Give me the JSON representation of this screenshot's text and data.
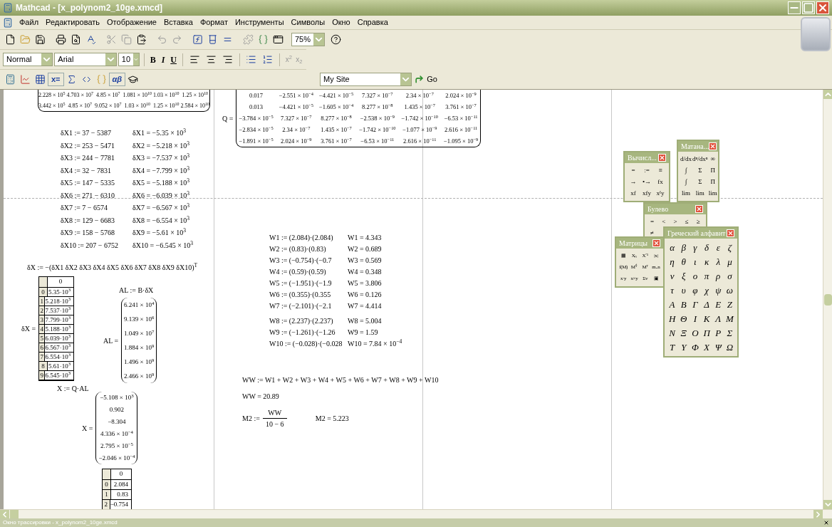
{
  "window": {
    "title": "Mathcad - [x_polynom2_10ge.xmcd]"
  },
  "menu": [
    "Файл",
    "Редактировать",
    "Отображение",
    "Вставка",
    "Формат",
    "Инструменты",
    "Символы",
    "Окно",
    "Справка"
  ],
  "standard_toolbar": {
    "zoom": "75%"
  },
  "formatting_toolbar": {
    "style": "Normal",
    "font": "Arial",
    "size": "10",
    "text_buttons": [
      "B",
      "I",
      "U"
    ],
    "script_buttons": [
      "x$^{2}$",
      "x$_{2}$"
    ]
  },
  "math_toolbar": {
    "evaluation_label": "x=",
    "greek_label": "αβ"
  },
  "web_toolbar": {
    "address": "My Site",
    "go": "Go"
  },
  "worksheet": {
    "top_matrix": {
      "rows": [
        [
          "2.228 × 10$^{5}$",
          "4.703 × 10$^{7}$",
          "4.85 × 10$^{7}$",
          "1.081 × 10$^{10}$",
          "1.03 × 10$^{10}$",
          "1.25 × 10$^{10}$"
        ],
        [
          "3.442 × 10$^{5}$",
          "4.85 × 10$^{7}$",
          "9.052 × 10$^{7}$",
          "1.03 × 10$^{10}$",
          "1.25 × 10$^{10}$",
          "2.584 × 10$^{10}$"
        ]
      ]
    },
    "q_matrix": {
      "label": "Q =",
      "rows": [
        [
          "0.017",
          "−2.551 × 10$^{−4}$",
          "−4.421 × 10$^{−5}$",
          "7.327 × 10$^{−7}$",
          "2.34 × 10$^{−7}$",
          "2.024 × 10$^{−9}$"
        ],
        [
          "0.013",
          "−4.421 × 10$^{−5}$",
          "−1.605 × 10$^{−4}$",
          "8.277 × 10$^{−8}$",
          "1.435 × 10$^{−7}$",
          "3.761 × 10$^{−7}$"
        ],
        [
          "−3.784 × 10$^{−5}$",
          "7.327 × 10$^{−7}$",
          "8.277 × 10$^{−8}$",
          "−2.538 × 10$^{−9}$",
          "−1.742 × 10$^{−10}$",
          "−6.53 × 10$^{−11}$"
        ],
        [
          "−2.834 × 10$^{−5}$",
          "2.34 × 10$^{−7}$",
          "1.435 × 10$^{−7}$",
          "−1.742 × 10$^{−10}$",
          "−1.077 × 10$^{−9}$",
          "2.616 × 10$^{−11}$"
        ],
        [
          "−1.891 × 10$^{−5}$",
          "2.024 × 10$^{−9}$",
          "3.761 × 10$^{−7}$",
          "−6.53 × 10$^{−11}$",
          "2.616 × 10$^{−11}$",
          "−1.095 × 10$^{−9}$"
        ]
      ]
    },
    "delta_definitions": [
      {
        "definition": "δX1 := 37 − 5387",
        "result": "δX1 = −5.35 × 10$^{3}$"
      },
      {
        "definition": "δX2 := 253 − 5471",
        "result": "δX2 = −5.218 × 10$^{3}$"
      },
      {
        "definition": "δX3 := 244 − 7781",
        "result": "δX3 = −7.537 × 10$^{3}$"
      },
      {
        "definition": "δX4 := 32 − 7831",
        "result": "δX4 = −7.799 × 10$^{3}$"
      },
      {
        "definition": "δX5 := 147 − 5335",
        "result": "δX5 = −5.188 × 10$^{3}$"
      },
      {
        "definition": "δX6 := 271 − 6310",
        "result": "δX6 = −6.039 × 10$^{3}$"
      },
      {
        "definition": "δX7 := 7 − 6574",
        "result": "δX7 = −6.567 × 10$^{3}$"
      },
      {
        "definition": "δX8 := 129 − 6683",
        "result": "δX8 = −6.554 × 10$^{3}$"
      },
      {
        "definition": "δX9 := 158 − 5768",
        "result": "δX9 = −5.61 × 10$^{3}$"
      },
      {
        "definition": "δX10 := 207 − 6752",
        "result": "δX10 = −6.545 × 10$^{3}$"
      }
    ],
    "delta_vector": "δX := −(δX1  δX2  δX3  δX4  δX5  δX6  δX7  δX8  δX9  δX10)$^{T}$",
    "delta_table": {
      "label": "δX =",
      "header": "0",
      "rows": [
        {
          "index": "0",
          "value": "5.35·10$^{3}$"
        },
        {
          "index": "1",
          "value": "5.218·10$^{3}$"
        },
        {
          "index": "2",
          "value": "7.537·10$^{3}$"
        },
        {
          "index": "3",
          "value": "7.799·10$^{3}$"
        },
        {
          "index": "4",
          "value": "5.188·10$^{3}$"
        },
        {
          "index": "5",
          "value": "6.039·10$^{3}$"
        },
        {
          "index": "6",
          "value": "6.567·10$^{3}$"
        },
        {
          "index": "7",
          "value": "6.554·10$^{3}$"
        },
        {
          "index": "8",
          "value": "5.61·10$^{3}$"
        },
        {
          "index": "9",
          "value": "6.545·10$^{3}$"
        }
      ]
    },
    "al_definition": "AL := B·δX",
    "al_matrix": {
      "label": "AL =",
      "rows": [
        [
          "6.241 × 10$^{4}$"
        ],
        [
          "9.139 × 10$^{6}$"
        ],
        [
          "1.049 × 10$^{7}$"
        ],
        [
          "1.884 × 10$^{9}$"
        ],
        [
          "1.496 × 10$^{9}$"
        ],
        [
          "2.466 × 10$^{9}$"
        ]
      ]
    },
    "x_definition": "X := Q·AL",
    "x_matrix": {
      "label": "X =",
      "rows": [
        [
          "−5.108 × 10$^{3}$"
        ],
        [
          "0.902"
        ],
        [
          "−8.304"
        ],
        [
          "4.336 × 10$^{−4}$"
        ],
        [
          "2.795 × 10$^{−5}$"
        ],
        [
          "−2.046 × 10$^{−4}$"
        ]
      ]
    },
    "x_table": {
      "header": "0",
      "rows": [
        {
          "index": "0",
          "value": "2.084"
        },
        {
          "index": "1",
          "value": "0.83"
        },
        {
          "index": "2",
          "value": "−0.754"
        }
      ]
    },
    "w_lines": [
      {
        "definition": "W1 := (2.084)·(2.084)",
        "result": "W1 = 4.343"
      },
      {
        "definition": "W2 := (0.83)·(0.83)",
        "result": "W2 = 0.689"
      },
      {
        "definition": "W3 := (−0.754)·(−0.7",
        "result": "W3 = 0.569"
      },
      {
        "definition": "W4 := (0.59)·(0.59)",
        "result": "W4 = 0.348"
      },
      {
        "definition": "W5 := (−1.951)·(−1.9",
        "result": "W5 = 3.806"
      },
      {
        "definition": "W6 := (0.355)·(0.355",
        "result": "W6 = 0.126"
      },
      {
        "definition": "W7 := (−2.101)·(−2.1",
        "result": "W7 = 4.414"
      },
      {
        "definition": "W8 := (2.237)·(2.237)",
        "result": "W8 = 5.004"
      },
      {
        "definition": "W9 := (−1.261)·(−1.26",
        "result": "W9 = 1.59"
      },
      {
        "definition": "W10 := (−0.028)·(−0.028",
        "result": "W10 = 7.84 × 10$^{−4}$"
      }
    ],
    "ww_definition": "WW := W1 + W2 + W3 + W4 + W5 + W6 + W7 + W8 + W9 + W10",
    "ww_result": "WW = 20.89",
    "m2": {
      "name": "M2 :=",
      "numerator": "WW",
      "denominator": "10 − 6",
      "result": "M2 = 5.223"
    }
  },
  "palettes": [
    {
      "title": "Вычисл...",
      "buttons": [
        "=",
        ":=",
        "≡",
        "→",
        "•→",
        "fx",
        "xf",
        "xfy",
        "xᶠy"
      ]
    },
    {
      "title": "Матана...",
      "buttons": [
        "d/dx",
        "dⁿ/dxⁿ",
        "∞",
        "∫",
        "Σ",
        "Π",
        "∫",
        "Σ",
        "Π",
        "lim",
        "lim",
        "lim"
      ]
    },
    {
      "title": "Булево",
      "buttons": [
        "=",
        "<",
        ">",
        "≤",
        "≥",
        "≠"
      ]
    },
    {
      "title": "Матрицы",
      "buttons": [
        "▦",
        "Xₙ",
        "X⁻¹",
        "|x|",
        "f(M)",
        "M⁽⁾",
        "Mᵀ",
        "m..n",
        "x·y",
        "x×y",
        "Σv",
        "▣"
      ]
    },
    {
      "title": "Греческий алфавит",
      "buttons": [
        "α",
        "β",
        "γ",
        "δ",
        "ε",
        "ζ",
        "η",
        "θ",
        "ι",
        "κ",
        "λ",
        "μ",
        "ν",
        "ξ",
        "ο",
        "π",
        "ρ",
        "σ",
        "τ",
        "υ",
        "φ",
        "χ",
        "ψ",
        "ω",
        "Α",
        "Β",
        "Γ",
        "Δ",
        "Ε",
        "Ζ",
        "Η",
        "Θ",
        "Ι",
        "Κ",
        "Λ",
        "Μ",
        "Ν",
        "Ξ",
        "Ο",
        "Π",
        "Ρ",
        "Σ",
        "Τ",
        "Υ",
        "Φ",
        "Χ",
        "Ψ",
        "Ω"
      ]
    }
  ],
  "status_bar": "Окно трассировки - x_polynom2_10ge.xmcd"
}
